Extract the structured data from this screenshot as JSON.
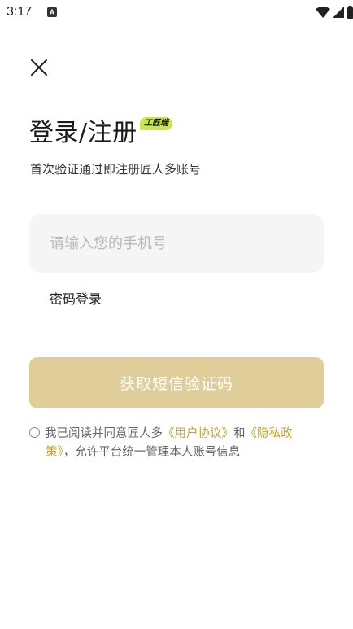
{
  "status_bar": {
    "time": "3:17",
    "app_icon_letter": "A"
  },
  "header": {
    "title": "登录/注册",
    "badge": "工匠端"
  },
  "subtitle": "首次验证通过即注册匠人多账号",
  "phone_input": {
    "placeholder": "请输入您的手机号",
    "value": ""
  },
  "password_login_label": "密码登录",
  "submit_button_label": "获取短信验证码",
  "agreement": {
    "prefix": "我已阅读并同意匠人多",
    "user_agreement": "《用户协议》",
    "and": "和",
    "privacy_policy_line1": "《隐私政",
    "privacy_policy_line2": "策》",
    "suffix": "，允许平台统一管理本人账号信息"
  },
  "colors": {
    "primary_button": "#e0ce9a",
    "link": "#c9a233",
    "badge": "#c8e84a",
    "input_bg": "#f5f5f5"
  }
}
